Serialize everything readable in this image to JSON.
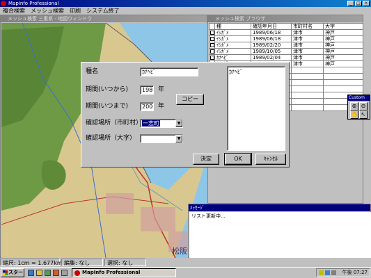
{
  "app": {
    "title": "MapInfo Professional"
  },
  "menu": [
    "複合検索",
    "メッシュ検索",
    "印刷",
    "システム終了"
  ],
  "map_window": {
    "title": "メッシュ検索 三重県 - 地図ウィンドウ",
    "place_label": "松阪市"
  },
  "browser_window": {
    "title": "メッシュ検索 ブラウザ",
    "columns": [
      "種",
      "確認年月日",
      "市町村名",
      "大字"
    ],
    "rows": [
      [
        "ｲｼｶﾞﾒ",
        "1989/06/18",
        "津市",
        "神戸"
      ],
      [
        "ｲｼｶﾞﾒ",
        "1989/06/18",
        "津市",
        "神戸"
      ],
      [
        "ｲｼｶﾞﾒ",
        "1989/02/20",
        "津市",
        "神戸"
      ],
      [
        "ｲｼｶﾞﾒ",
        "1989/10/05",
        "津市",
        "神戸"
      ],
      [
        "ｶﾅﾍﾋﾞ",
        "1989/02/04",
        "津市",
        "神戸"
      ],
      [
        "ｶﾅﾍﾋﾞ",
        "1989/10/05",
        "津市",
        "神戸"
      ],
      [
        "",
        "",
        "",
        ""
      ],
      [
        "",
        "",
        "",
        ""
      ],
      [
        "",
        "",
        "",
        ""
      ],
      [
        "",
        "",
        "",
        ""
      ],
      [
        "",
        "",
        "",
        ""
      ],
      [
        "",
        "",
        "",
        ""
      ],
      [
        "",
        "",
        "",
        ""
      ]
    ]
  },
  "dialog": {
    "species_label": "種名",
    "species_value": "ｶﾅﾍﾋﾞ",
    "from_label": "期間(いつから)",
    "from_value": "1980",
    "to_label": "期間(いつまで)",
    "to_value": "2000",
    "year_unit": "年",
    "copy_button": "コピー",
    "city_label": "確認場所（市町村）",
    "city_value": "一志町",
    "district_label": "確認場所（大字）",
    "district_value": "",
    "list_items": [
      "ｶﾅﾍﾋﾞ"
    ],
    "decide_button": "決定",
    "ok_button": "OK",
    "cancel_button": "ｷｬﾝｾﾙ"
  },
  "custom_toolbar": {
    "title": "Custom",
    "buttons": [
      "zoom-in-icon",
      "zoom-out-icon",
      "hand-icon",
      "arrow-cursor-icon"
    ]
  },
  "message_window": {
    "title": "ﾒｯｾｰｼﾞ",
    "text": "リスト更新中..."
  },
  "status_bar": {
    "scale": "縮尺: 1cm = 1.677km",
    "edit": "編集: なし",
    "select": "選択: なし"
  },
  "taskbar": {
    "start_label": "スタート",
    "task_label": "MapInfo Professional",
    "clock": "午後 07:27"
  },
  "colors": {
    "title_active": "#000080",
    "title_inactive": "#808080",
    "face": "#c0c0c0",
    "map_land": "#d8c890",
    "map_water": "#8ec6e8",
    "map_forest": "#6f9a45"
  }
}
